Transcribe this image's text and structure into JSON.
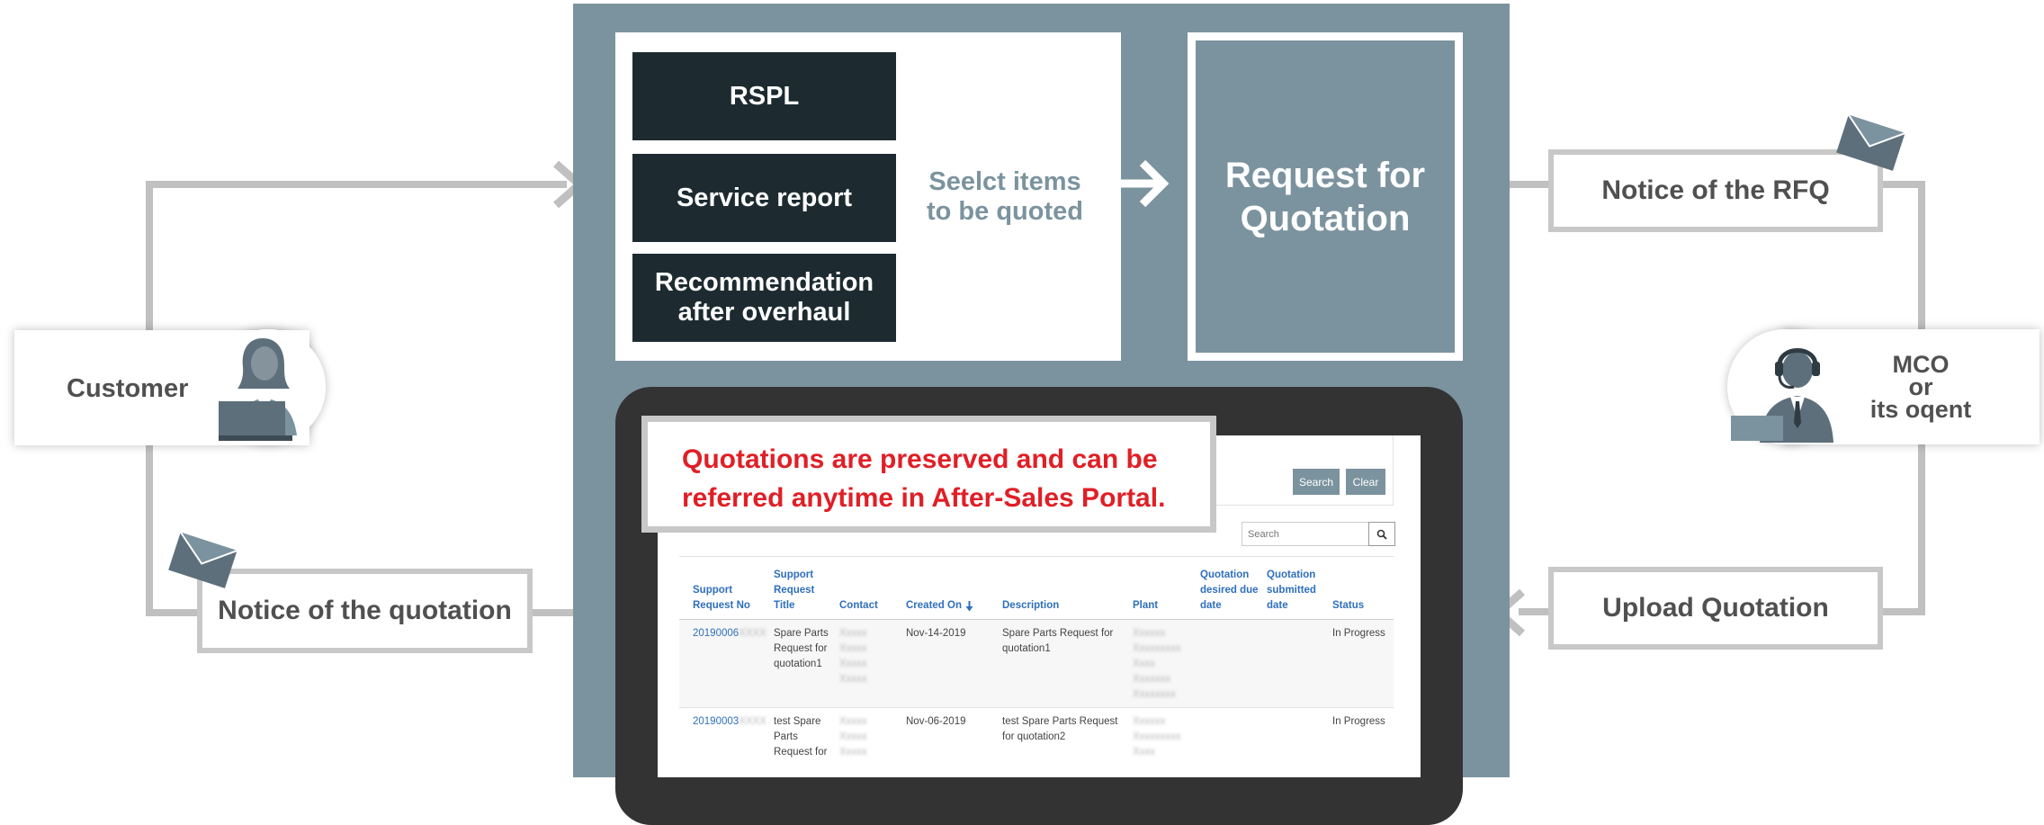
{
  "documents": {
    "rspl": "RSPL",
    "service_report_label": "Service report",
    "recommendation_line1": "Recommendation",
    "recommendation_line2": "after overhaul"
  },
  "select_items": {
    "line1": "Seelct items",
    "line2": "to be quoted"
  },
  "rfq": {
    "line1": "Request for",
    "line2": "Quotation"
  },
  "callout": {
    "line1": "Quotations are preserved and can be",
    "line2": "referred anytime in After-Sales Portal."
  },
  "portal": {
    "search_button": "Search",
    "clear_button": "Clear",
    "search_placeholder": "Search",
    "columns": [
      [
        "Support",
        "Request No"
      ],
      [
        "Support",
        "Request",
        "Title"
      ],
      [
        "Contact"
      ],
      [
        "Created On"
      ],
      [
        "Description"
      ],
      [
        "Plant"
      ],
      [
        "Quotation",
        "desired due",
        "date"
      ],
      [
        "Quotation",
        "submitted",
        "date"
      ],
      [
        "Status"
      ]
    ],
    "rows": [
      {
        "request_no": "20190006",
        "title": [
          "Spare Parts",
          "Request for",
          "quotation1"
        ],
        "created_on": "Nov-14-2019",
        "description": [
          "Spare Parts Request for",
          "quotation1"
        ],
        "status": "In Progress"
      },
      {
        "request_no": "20190003",
        "title": [
          "test Spare",
          "Parts",
          "Request for"
        ],
        "created_on": "Nov-06-2019",
        "description": [
          "test Spare Parts Request",
          "for quotation2"
        ],
        "status": "In Progress"
      }
    ]
  },
  "labels": {
    "customer": "Customer",
    "notice_rfq": "Notice of the RFQ",
    "notice_quotation": "Notice of the quotation",
    "upload_quotation": "Upload Quotation",
    "mco_line1": "MCO",
    "mco_line2": "or",
    "mco_line3": "its oqent"
  },
  "colors": {
    "panel": "#7b939e",
    "dark_block": "#1d2b31",
    "callout_red": "#e01f26",
    "connector": "#c0c0c0",
    "link_blue": "#2f6fbd"
  }
}
